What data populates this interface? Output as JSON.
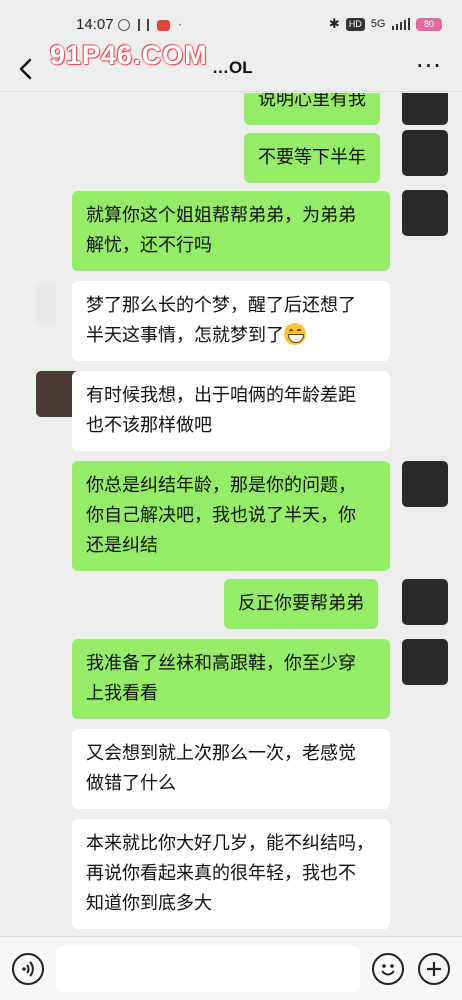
{
  "status_bar": {
    "time": "14:07",
    "network": "5G",
    "hd": "HD",
    "battery": "80"
  },
  "header": {
    "title_visible": "…OL",
    "watermark": "91P46.COM",
    "back_icon": "chevron-left-icon",
    "more_icon": "more-dots-icon",
    "more_label": "···"
  },
  "messages": [
    {
      "side": "out",
      "text": "说明心里有我"
    },
    {
      "side": "out",
      "text": "不要等下半年"
    },
    {
      "side": "out",
      "lines": [
        "就算你这个姐姐帮帮弟弟，为弟弟",
        "解忧，还不行吗"
      ]
    },
    {
      "side": "in",
      "lines": [
        "梦了那么长的个梦，醒了后还想了",
        "半天这事情，怎就梦到了"
      ],
      "emoji": "grin-emoji"
    },
    {
      "side": "in",
      "lines": [
        "有时候我想，出于咱俩的年龄差距",
        "也不该那样做吧"
      ]
    },
    {
      "side": "out",
      "lines": [
        "你总是纠结年龄，那是你的问题，",
        "你自己解决吧，我也说了半天，你",
        "还是纠结"
      ]
    },
    {
      "side": "out",
      "text": "反正你要帮弟弟"
    },
    {
      "side": "out",
      "lines": [
        "我准备了丝袜和高跟鞋，你至少穿",
        "上我看看"
      ]
    },
    {
      "side": "in",
      "lines": [
        "又会想到就上次那么一次，老感觉",
        "做错了什么"
      ]
    },
    {
      "side": "in",
      "lines": [
        "本来就比你大好几岁，能不纠结吗，",
        "再说你看起来真的很年轻，我也不",
        "知道你到底多大"
      ]
    }
  ],
  "bottom_bar": {
    "voice_icon": "voice-icon",
    "emoji_icon": "emoji-icon",
    "plus_icon": "plus-icon",
    "input_value": ""
  },
  "colors": {
    "outgoing_bubble": "#95ec69",
    "incoming_bubble": "#ffffff",
    "background": "#ededed"
  }
}
